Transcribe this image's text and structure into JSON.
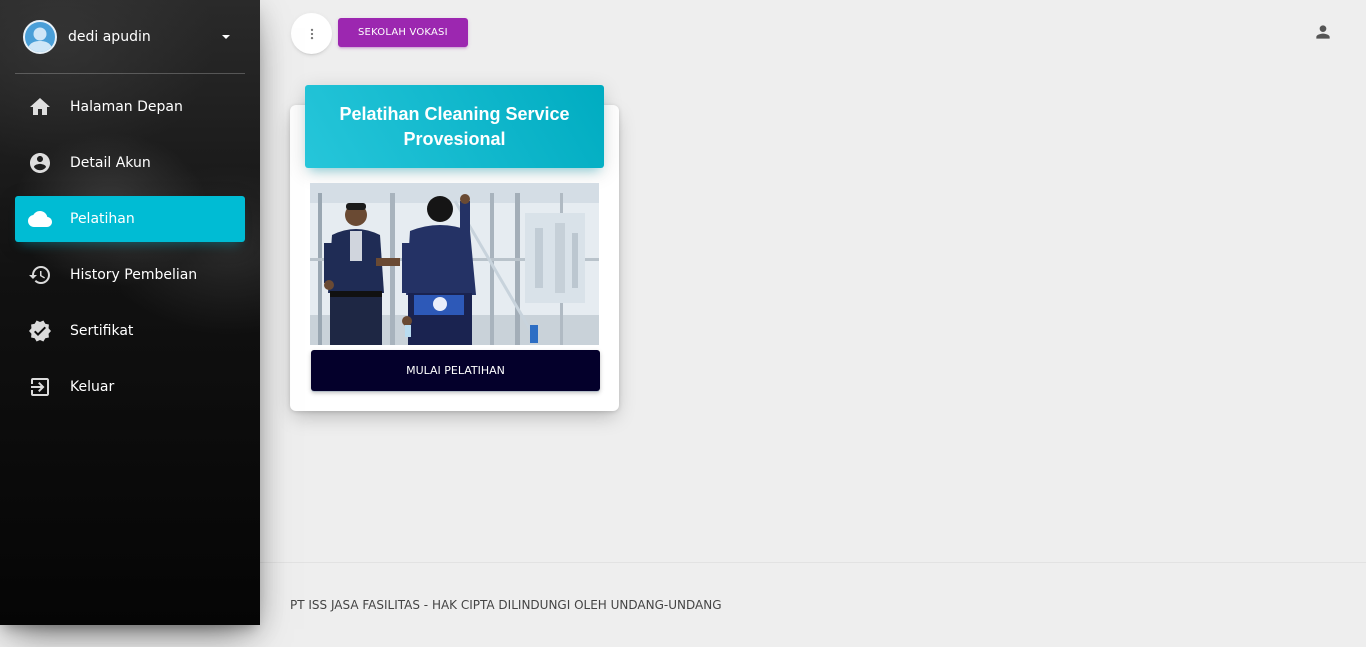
{
  "sidebar": {
    "user": {
      "name": "dedi apudin"
    },
    "items": [
      {
        "label": "Halaman Depan",
        "icon": "home-icon"
      },
      {
        "label": "Detail Akun",
        "icon": "account-circle-icon"
      },
      {
        "label": "Pelatihan",
        "icon": "cloud-icon",
        "active": true
      },
      {
        "label": "History Pembelian",
        "icon": "history-icon"
      },
      {
        "label": "Sertifikat",
        "icon": "verified-badge-icon"
      },
      {
        "label": "Keluar",
        "icon": "exit-icon"
      }
    ]
  },
  "topbar": {
    "brand_label": "SEKOLAH VOKASI",
    "menu_icon": "more-vertical-icon",
    "profile_icon": "person-icon"
  },
  "course_card": {
    "title": "Pelatihan Cleaning Service Provesional",
    "button_label": "MULAI PELATIHAN",
    "image_description_icon": "photo"
  },
  "footer": {
    "text": "PT ISS JASA FASILITAS - HAK CIPTA DILINDUNGI OLEH UNDANG-UNDANG"
  },
  "colors": {
    "active_nav": "#00bcd4",
    "brand_button": "#9c27b0",
    "start_button": "#04002b",
    "card_header": "#26c6da"
  }
}
